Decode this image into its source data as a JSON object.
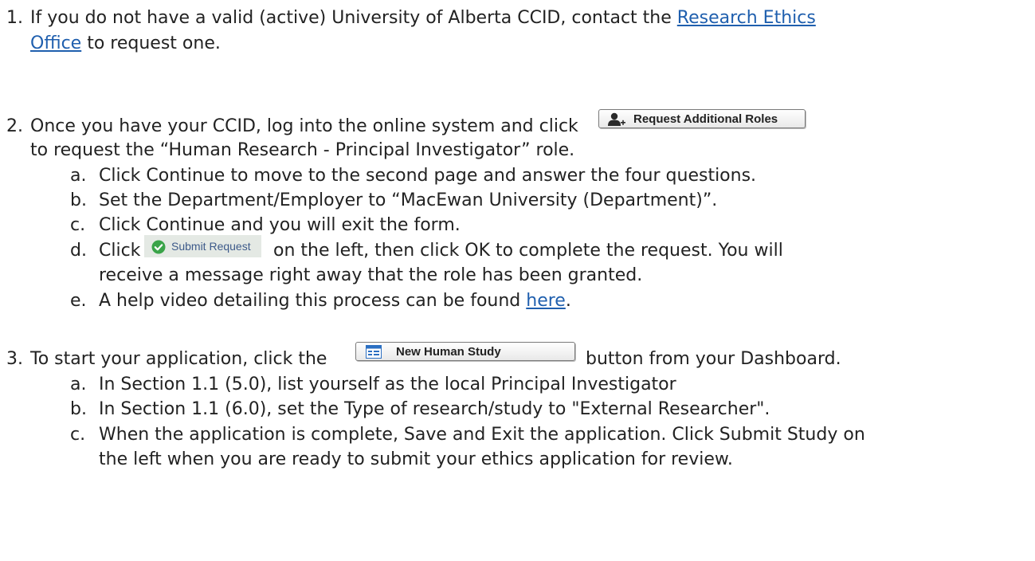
{
  "item1": {
    "number": "1.",
    "line1_before": "If you do not have a valid (active) University of Alberta CCID, contact the ",
    "link_part1": "Research Ethics",
    "link_part2": "Office",
    "line2_after": " to request one."
  },
  "item2": {
    "number": "2.",
    "line1_before": "Once you have your CCID, log into the online system and click",
    "button_label": "Request Additional Roles",
    "button_icon": "user-add-icon",
    "line2": "to request the “Human Research - Principal Investigator” role.",
    "sub": {
      "a_letter": "a.",
      "a_text": "Click Continue to move to the second page and answer the four questions.",
      "b_letter": "b.",
      "b_text": "Set the Department/Employer to “MacEwan University (Department)”.",
      "c_letter": "c.",
      "c_text": "Click Continue and you will exit the form.",
      "d_letter": "d.",
      "d_before": "Click",
      "d_button_label": "Submit Request",
      "d_button_icon": "check-circle-icon",
      "d_after": "on the left, then click OK to complete the request.  You will",
      "d_line2": "receive a message right away that the role has been granted.",
      "e_letter": "e.",
      "e_before": "A help video detailing this process can be found ",
      "e_link": "here",
      "e_after": "."
    }
  },
  "item3": {
    "number": "3.",
    "line1_before": "To start your application, click the",
    "button_label": "New Human Study",
    "button_icon": "study-form-icon",
    "line1_after": "button from your Dashboard.",
    "sub": {
      "a_letter": "a.",
      "a_text": "In Section 1.1 (5.0), list yourself as the local Principal Investigator",
      "b_letter": "b.",
      "b_text": "In Section 1.1 (6.0), set the Type of research/study to \"External Researcher\".",
      "c_letter": "c.",
      "c_text": "When the application is complete, Save and Exit the application.  Click Submit Study on",
      "c_line2": "the left when you are ready to submit your ethics application for review."
    }
  },
  "colors": {
    "link": "#1f5fae",
    "text": "#222222",
    "submit_bg": "#e4e9e4",
    "submit_check": "#3aa449",
    "new_study_icon": "#2b6fc2"
  }
}
